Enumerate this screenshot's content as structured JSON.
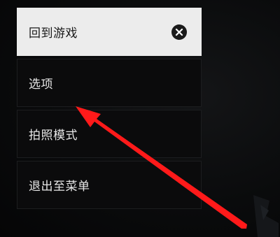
{
  "menu": {
    "items": [
      {
        "label": "回到游戏",
        "active": true,
        "icon": "close-circle-icon"
      },
      {
        "label": "选项",
        "active": false
      },
      {
        "label": "拍照模式",
        "active": false
      },
      {
        "label": "退出至菜单",
        "active": false
      }
    ]
  },
  "colors": {
    "background": "#08090a",
    "active_item": "#ececec",
    "item": "#0b0b0c",
    "arrow": "#ff1a1a"
  }
}
